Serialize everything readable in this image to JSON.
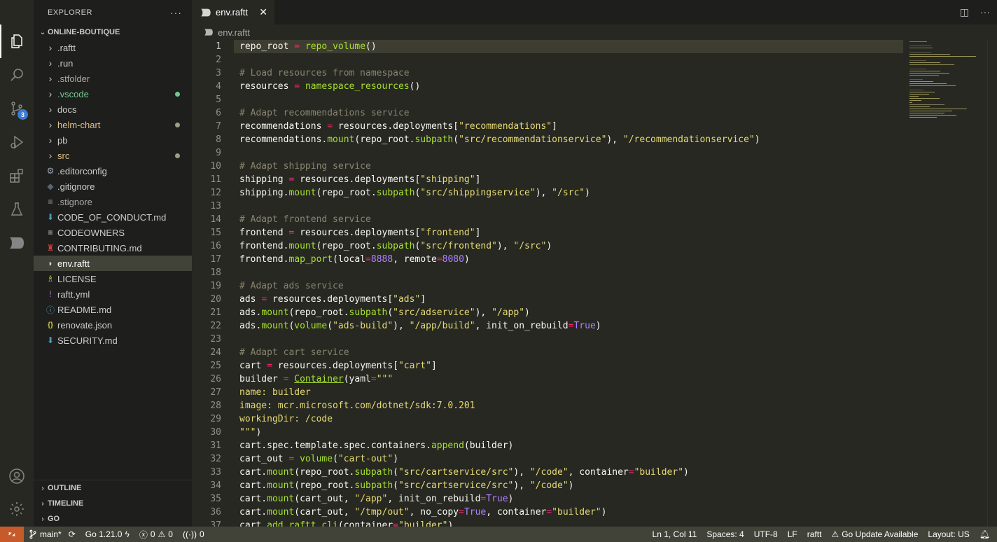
{
  "activity": {
    "scm_badge": "3"
  },
  "sidebar": {
    "title": "EXPLORER",
    "more": "···",
    "root": "ONLINE-BOUTIQUE",
    "items": [
      {
        "label": ".raftt",
        "kind": "folder",
        "color": "#cccccc",
        "icon": "chevron-right-icon"
      },
      {
        "label": ".run",
        "kind": "folder",
        "color": "#cccccc",
        "icon": "chevron-right-icon"
      },
      {
        "label": ".stfolder",
        "kind": "folder",
        "color": "#a9a9a9",
        "icon": "chevron-right-icon"
      },
      {
        "label": ".vscode",
        "kind": "folder",
        "color": "#73c991",
        "icon": "chevron-right-icon",
        "dot": "#73c991"
      },
      {
        "label": "docs",
        "kind": "folder",
        "color": "#cccccc",
        "icon": "chevron-right-icon"
      },
      {
        "label": "helm-chart",
        "kind": "folder",
        "color": "#e2c08d",
        "icon": "chevron-right-icon",
        "dot": "#a09e87"
      },
      {
        "label": "pb",
        "kind": "folder",
        "color": "#cccccc",
        "icon": "chevron-right-icon"
      },
      {
        "label": "src",
        "kind": "folder",
        "color": "#e2c08d",
        "icon": "chevron-right-icon",
        "dot": "#a09e87"
      },
      {
        "label": ".editorconfig",
        "kind": "file",
        "color": "#cccccc",
        "icon": "gear-file-icon",
        "glyph": "⚙",
        "glyphColor": "#9aa4b0"
      },
      {
        "label": ".gitignore",
        "kind": "file",
        "color": "#cccccc",
        "icon": "git-file-icon",
        "glyph": "◆",
        "glyphColor": "#5c6670"
      },
      {
        "label": ".stignore",
        "kind": "file",
        "color": "#a9a9a9",
        "icon": "text-file-icon",
        "glyph": "≡",
        "glyphColor": "#9a9a9a"
      },
      {
        "label": "CODE_OF_CONDUCT.md",
        "kind": "file",
        "color": "#cccccc",
        "icon": "markdown-file-icon",
        "glyph": "⬇",
        "glyphColor": "#519aba"
      },
      {
        "label": "CODEOWNERS",
        "kind": "file",
        "color": "#cccccc",
        "icon": "text-file-icon",
        "glyph": "≡",
        "glyphColor": "#cccccc"
      },
      {
        "label": "CONTRIBUTING.md",
        "kind": "file",
        "color": "#cccccc",
        "icon": "contributing-file-icon",
        "glyph": "♜",
        "glyphColor": "#cc3e44"
      },
      {
        "label": "env.raftt",
        "kind": "file",
        "color": "#ffffff",
        "icon": "raftt-file-icon",
        "glyph": "◗",
        "glyphColor": "#d4d4d4",
        "selected": true
      },
      {
        "label": "LICENSE",
        "kind": "file",
        "color": "#cccccc",
        "icon": "license-file-icon",
        "glyph": "♗",
        "glyphColor": "#cbcb41"
      },
      {
        "label": "raftt.yml",
        "kind": "file",
        "color": "#cccccc",
        "icon": "yaml-file-icon",
        "glyph": "!",
        "glyphColor": "#a074c4"
      },
      {
        "label": "README.md",
        "kind": "file",
        "color": "#cccccc",
        "icon": "info-file-icon",
        "glyph": "ⓘ",
        "glyphColor": "#519aba"
      },
      {
        "label": "renovate.json",
        "kind": "file",
        "color": "#cccccc",
        "icon": "json-file-icon",
        "glyph": "{}",
        "glyphColor": "#cbcb41"
      },
      {
        "label": "SECURITY.md",
        "kind": "file",
        "color": "#cccccc",
        "icon": "markdown-file-icon",
        "glyph": "⬇",
        "glyphColor": "#519aba"
      }
    ],
    "sections": [
      "OUTLINE",
      "TIMELINE",
      "GO"
    ]
  },
  "tab": {
    "label": "env.raftt",
    "close": "✕"
  },
  "breadcrumb": "env.raftt",
  "code": [
    [
      [
        "repo_root ",
        ""
      ],
      [
        "=",
        "op"
      ],
      [
        " ",
        ""
      ],
      [
        "repo_volume",
        "fn"
      ],
      [
        "()",
        ""
      ]
    ],
    [],
    [
      [
        "# Load resources from namespace",
        "com"
      ]
    ],
    [
      [
        "resources ",
        ""
      ],
      [
        "=",
        "op"
      ],
      [
        " ",
        ""
      ],
      [
        "namespace_resources",
        "fn"
      ],
      [
        "()",
        ""
      ]
    ],
    [],
    [
      [
        "# Adapt recommendations service",
        "com"
      ]
    ],
    [
      [
        "recommendations ",
        ""
      ],
      [
        "=",
        "op"
      ],
      [
        " resources.deployments[",
        ""
      ],
      [
        "\"recommendations\"",
        "str"
      ],
      [
        "]",
        ""
      ]
    ],
    [
      [
        "recommendations.",
        ""
      ],
      [
        "mount",
        "fn"
      ],
      [
        "(repo_root.",
        ""
      ],
      [
        "subpath",
        "fn"
      ],
      [
        "(",
        ""
      ],
      [
        "\"src/recommendationservice\"",
        "str"
      ],
      [
        "), ",
        ""
      ],
      [
        "\"/recommendationservice\"",
        "str"
      ],
      [
        ")",
        ""
      ]
    ],
    [],
    [
      [
        "# Adapt shipping service",
        "com"
      ]
    ],
    [
      [
        "shipping ",
        ""
      ],
      [
        "=",
        "op"
      ],
      [
        " resources.deployments[",
        ""
      ],
      [
        "\"shipping\"",
        "str"
      ],
      [
        "]",
        ""
      ]
    ],
    [
      [
        "shipping.",
        ""
      ],
      [
        "mount",
        "fn"
      ],
      [
        "(repo_root.",
        ""
      ],
      [
        "subpath",
        "fn"
      ],
      [
        "(",
        ""
      ],
      [
        "\"src/shippingservice\"",
        "str"
      ],
      [
        "), ",
        ""
      ],
      [
        "\"/src\"",
        "str"
      ],
      [
        ")",
        ""
      ]
    ],
    [],
    [
      [
        "# Adapt frontend service",
        "com"
      ]
    ],
    [
      [
        "frontend ",
        ""
      ],
      [
        "=",
        "op"
      ],
      [
        " resources.deployments[",
        ""
      ],
      [
        "\"frontend\"",
        "str"
      ],
      [
        "]",
        ""
      ]
    ],
    [
      [
        "frontend.",
        ""
      ],
      [
        "mount",
        "fn"
      ],
      [
        "(repo_root.",
        ""
      ],
      [
        "subpath",
        "fn"
      ],
      [
        "(",
        ""
      ],
      [
        "\"src/frontend\"",
        "str"
      ],
      [
        "), ",
        ""
      ],
      [
        "\"/src\"",
        "str"
      ],
      [
        ")",
        ""
      ]
    ],
    [
      [
        "frontend.",
        ""
      ],
      [
        "map_port",
        "fn"
      ],
      [
        "(local",
        ""
      ],
      [
        "=",
        "op"
      ],
      [
        "8888",
        "num"
      ],
      [
        ", remote",
        ""
      ],
      [
        "=",
        "op"
      ],
      [
        "8080",
        "num"
      ],
      [
        ")",
        ""
      ]
    ],
    [],
    [
      [
        "# Adapt ads service",
        "com"
      ]
    ],
    [
      [
        "ads ",
        ""
      ],
      [
        "=",
        "op"
      ],
      [
        " resources.deployments[",
        ""
      ],
      [
        "\"ads\"",
        "str"
      ],
      [
        "]",
        ""
      ]
    ],
    [
      [
        "ads.",
        ""
      ],
      [
        "mount",
        "fn"
      ],
      [
        "(repo_root.",
        ""
      ],
      [
        "subpath",
        "fn"
      ],
      [
        "(",
        ""
      ],
      [
        "\"src/adservice\"",
        "str"
      ],
      [
        "), ",
        ""
      ],
      [
        "\"/app\"",
        "str"
      ],
      [
        ")",
        ""
      ]
    ],
    [
      [
        "ads.",
        ""
      ],
      [
        "mount",
        "fn"
      ],
      [
        "(",
        ""
      ],
      [
        "volume",
        "fn"
      ],
      [
        "(",
        ""
      ],
      [
        "\"ads-build\"",
        "str"
      ],
      [
        "), ",
        ""
      ],
      [
        "\"/app/build\"",
        "str"
      ],
      [
        ", init_on_rebuild",
        ""
      ],
      [
        "=",
        "op"
      ],
      [
        "True",
        "num"
      ],
      [
        ")",
        ""
      ]
    ],
    [],
    [
      [
        "# Adapt cart service",
        "com"
      ]
    ],
    [
      [
        "cart ",
        ""
      ],
      [
        "=",
        "op"
      ],
      [
        " resources.deployments[",
        ""
      ],
      [
        "\"cart\"",
        "str"
      ],
      [
        "]",
        ""
      ]
    ],
    [
      [
        "builder ",
        ""
      ],
      [
        "=",
        "op"
      ],
      [
        " ",
        ""
      ],
      [
        "Container",
        "cls"
      ],
      [
        "(yaml",
        ""
      ],
      [
        "=",
        "op"
      ],
      [
        "\"\"\"",
        "str"
      ]
    ],
    [
      [
        "name: builder",
        "str"
      ]
    ],
    [
      [
        "image: mcr.microsoft.com/dotnet/sdk:7.0.201",
        "str"
      ]
    ],
    [
      [
        "workingDir: /code",
        "str"
      ]
    ],
    [
      [
        "\"\"\"",
        "str"
      ],
      [
        ")",
        ""
      ]
    ],
    [
      [
        "cart.spec.template.spec.containers.",
        ""
      ],
      [
        "append",
        "fn"
      ],
      [
        "(builder)",
        ""
      ]
    ],
    [
      [
        "cart_out ",
        ""
      ],
      [
        "=",
        "op"
      ],
      [
        " ",
        ""
      ],
      [
        "volume",
        "fn"
      ],
      [
        "(",
        ""
      ],
      [
        "\"cart-out\"",
        "str"
      ],
      [
        ")",
        ""
      ]
    ],
    [
      [
        "cart.",
        ""
      ],
      [
        "mount",
        "fn"
      ],
      [
        "(repo_root.",
        ""
      ],
      [
        "subpath",
        "fn"
      ],
      [
        "(",
        ""
      ],
      [
        "\"src/cartservice/src\"",
        "str"
      ],
      [
        "), ",
        ""
      ],
      [
        "\"/code\"",
        "str"
      ],
      [
        ", container",
        ""
      ],
      [
        "=",
        "op"
      ],
      [
        "\"builder\"",
        "str"
      ],
      [
        ")",
        ""
      ]
    ],
    [
      [
        "cart.",
        ""
      ],
      [
        "mount",
        "fn"
      ],
      [
        "(repo_root.",
        ""
      ],
      [
        "subpath",
        "fn"
      ],
      [
        "(",
        ""
      ],
      [
        "\"src/cartservice/src\"",
        "str"
      ],
      [
        "), ",
        ""
      ],
      [
        "\"/code\"",
        "str"
      ],
      [
        ")",
        ""
      ]
    ],
    [
      [
        "cart.",
        ""
      ],
      [
        "mount",
        "fn"
      ],
      [
        "(cart_out, ",
        ""
      ],
      [
        "\"/app\"",
        "str"
      ],
      [
        ", init_on_rebuild",
        ""
      ],
      [
        "=",
        "op"
      ],
      [
        "True",
        "num"
      ],
      [
        ")",
        ""
      ]
    ],
    [
      [
        "cart.",
        ""
      ],
      [
        "mount",
        "fn"
      ],
      [
        "(cart_out, ",
        ""
      ],
      [
        "\"/tmp/out\"",
        "str"
      ],
      [
        ", no_copy",
        ""
      ],
      [
        "=",
        "op"
      ],
      [
        "True",
        "num"
      ],
      [
        ", container",
        ""
      ],
      [
        "=",
        "op"
      ],
      [
        "\"builder\"",
        "str"
      ],
      [
        ")",
        ""
      ]
    ],
    [
      [
        "cart.",
        ""
      ],
      [
        "add_raftt_cli",
        "fn"
      ],
      [
        "(container",
        ""
      ],
      [
        "=",
        "op"
      ],
      [
        "\"builder\"",
        "str"
      ],
      [
        ")",
        ""
      ]
    ]
  ],
  "status": {
    "branch": "main*",
    "go_version": "Go 1.21.0",
    "errors": "0",
    "warnings": "0",
    "ports": "0",
    "cursor": "Ln 1, Col 11",
    "spaces": "Spaces: 4",
    "encoding": "UTF-8",
    "eol": "LF",
    "language": "raftt",
    "go_update": "Go Update Available",
    "layout": "Layout: US"
  }
}
